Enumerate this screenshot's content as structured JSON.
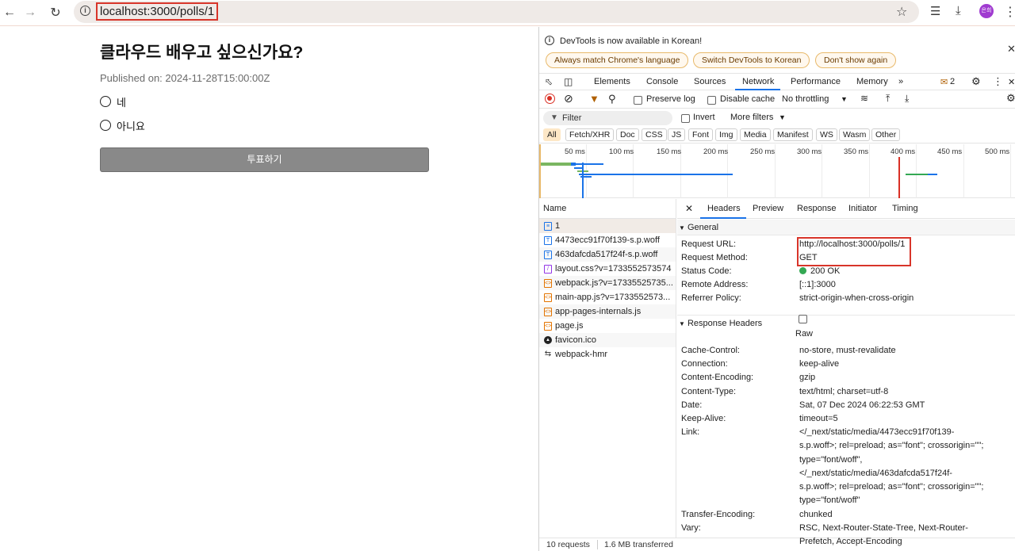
{
  "browser": {
    "url": "localhost:3000/polls/1",
    "avatar_text": "은희"
  },
  "poll": {
    "title": "클라우드 배우고 싶으신가요?",
    "published": "Published on: 2024-11-28T15:00:00Z",
    "options": [
      "네",
      "아니요"
    ],
    "vote_label": "투표하기"
  },
  "devtools": {
    "notice": "DevTools is now available in Korean!",
    "notice_buttons": [
      "Always match Chrome's language",
      "Switch DevTools to Korean",
      "Don't show again"
    ],
    "tabs": [
      "Elements",
      "Console",
      "Sources",
      "Network",
      "Performance",
      "Memory"
    ],
    "active_tab": "Network",
    "issues_count": "2",
    "toolbar": {
      "preserve_log": "Preserve log",
      "disable_cache": "Disable cache",
      "throttling": "No throttling"
    },
    "filter": {
      "placeholder": "Filter",
      "invert": "Invert",
      "more_filters": "More filters"
    },
    "type_filters": [
      "All",
      "Fetch/XHR",
      "Doc",
      "CSS",
      "JS",
      "Font",
      "Img",
      "Media",
      "Manifest",
      "WS",
      "Wasm",
      "Other"
    ],
    "timeline_ticks": [
      "50 ms",
      "100 ms",
      "150 ms",
      "200 ms",
      "250 ms",
      "300 ms",
      "350 ms",
      "400 ms",
      "450 ms",
      "500 ms"
    ],
    "name_header": "Name",
    "requests": [
      {
        "name": "1",
        "icon": "document-icon"
      },
      {
        "name": "4473ecc91f70f139-s.p.woff",
        "icon": "font-icon"
      },
      {
        "name": "463dafcda517f24f-s.p.woff",
        "icon": "font-icon"
      },
      {
        "name": "layout.css?v=1733552573574",
        "icon": "stylesheet-icon"
      },
      {
        "name": "webpack.js?v=17335525735...",
        "icon": "script-icon"
      },
      {
        "name": "main-app.js?v=1733552573...",
        "icon": "script-icon"
      },
      {
        "name": "app-pages-internals.js",
        "icon": "script-icon"
      },
      {
        "name": "page.js",
        "icon": "script-icon"
      },
      {
        "name": "favicon.ico",
        "icon": "favicon-icon"
      },
      {
        "name": "webpack-hmr",
        "icon": "websocket-icon"
      }
    ],
    "footer": {
      "requests": "10 requests",
      "transferred": "1.6 MB transferred"
    },
    "detail_tabs": [
      "Headers",
      "Preview",
      "Response",
      "Initiator",
      "Timing"
    ],
    "active_detail_tab": "Headers",
    "general": {
      "title": "General",
      "rows": [
        {
          "key": "Request URL:",
          "value": "http://localhost:3000/polls/1"
        },
        {
          "key": "Request Method:",
          "value": "GET"
        },
        {
          "key": "Status Code:",
          "value": "200 OK"
        },
        {
          "key": "Remote Address:",
          "value": "[::1]:3000"
        },
        {
          "key": "Referrer Policy:",
          "value": "strict-origin-when-cross-origin"
        }
      ]
    },
    "response_headers": {
      "title": "Response Headers",
      "raw_label": "Raw",
      "rows": [
        {
          "key": "Cache-Control:",
          "value": "no-store, must-revalidate"
        },
        {
          "key": "Connection:",
          "value": "keep-alive"
        },
        {
          "key": "Content-Encoding:",
          "value": "gzip"
        },
        {
          "key": "Content-Type:",
          "value": "text/html; charset=utf-8"
        },
        {
          "key": "Date:",
          "value": "Sat, 07 Dec 2024 06:22:53 GMT"
        },
        {
          "key": "Keep-Alive:",
          "value": "timeout=5"
        },
        {
          "key": "Link:",
          "value_lines": [
            "</_next/static/media/4473ecc91f70f139-",
            "s.p.woff>; rel=preload; as=\"font\"; crossorigin=\"\";",
            "type=\"font/woff\",",
            "</_next/static/media/463dafcda517f24f-",
            "s.p.woff>; rel=preload; as=\"font\"; crossorigin=\"\";",
            "type=\"font/woff\""
          ]
        },
        {
          "key": "Transfer-Encoding:",
          "value": "chunked"
        },
        {
          "key": "Vary:",
          "value_lines": [
            "RSC, Next-Router-State-Tree, Next-Router-",
            "Prefetch, Accept-Encoding"
          ]
        }
      ]
    },
    "colors": {
      "accent": "#1a73e8",
      "highlight_box": "#d8352a",
      "status_ok": "#34a853"
    }
  }
}
